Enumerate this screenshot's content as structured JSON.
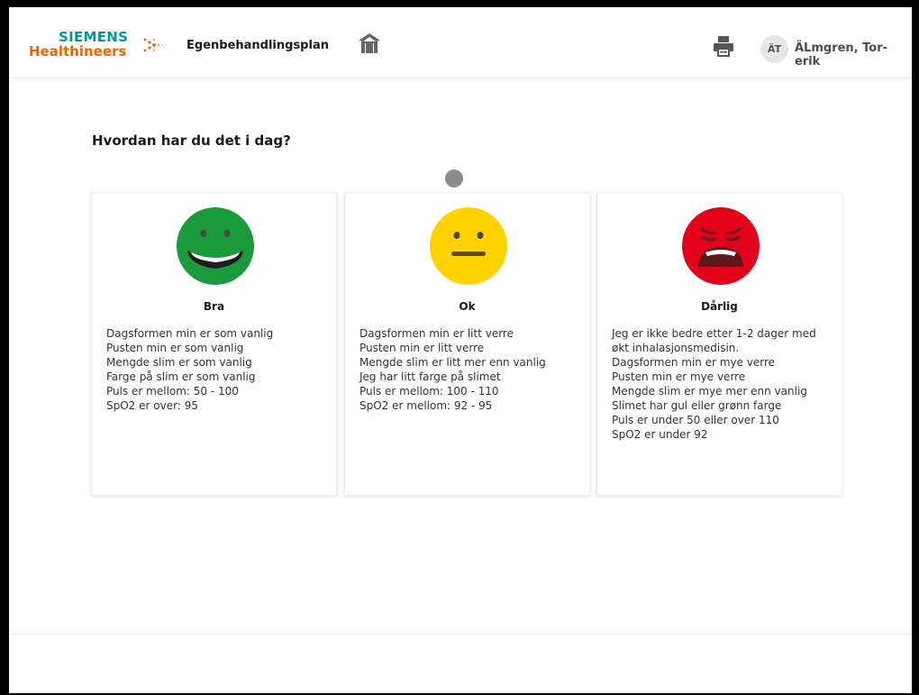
{
  "header": {
    "logo_line1": "SIEMENS",
    "logo_line2": "Healthineers",
    "app_title": "Egenbehandlingsplan",
    "user_initials": "ÄT",
    "user_name": "ÄLmgren, Tor-erik"
  },
  "colors": {
    "siemens_teal": "#009999",
    "healthineers_orange": "#ec6602",
    "good_green": "#1a9a3a",
    "ok_yellow": "#ffd200",
    "bad_red": "#e3001b"
  },
  "main": {
    "question": "Hvordan har du det i dag?",
    "cards": [
      {
        "icon": "smiling-face-icon",
        "title": "Bra",
        "lines": [
          "Dagsformen min er som vanlig",
          "Pusten min er som vanlig",
          "Mengde slim er som vanlig",
          "Farge på slim er som vanlig",
          "Puls er mellom: 50 - 100",
          "SpO2 er over: 95"
        ]
      },
      {
        "icon": "neutral-face-icon",
        "title": "Ok",
        "lines": [
          "Dagsformen min er litt verre",
          "Pusten min er litt verre",
          "Mengde slim er litt mer enn vanlig",
          "Jeg har litt farge på slimet",
          "Puls er mellom: 100 - 110",
          "SpO2 er mellom: 92 - 95"
        ]
      },
      {
        "icon": "distressed-face-icon",
        "title": "Dårlig",
        "lines": [
          "Jeg er ikke bedre etter 1-2 dager med",
          "økt inhalasjonsmedisin.",
          "Dagsformen min er mye verre",
          "Pusten min er mye verre",
          "Mengde slim er mye mer enn vanlig",
          "Slimet har gul eller grønn farge",
          "Puls er under 50 eller over 110",
          "SpO2 er under 92"
        ]
      }
    ]
  }
}
